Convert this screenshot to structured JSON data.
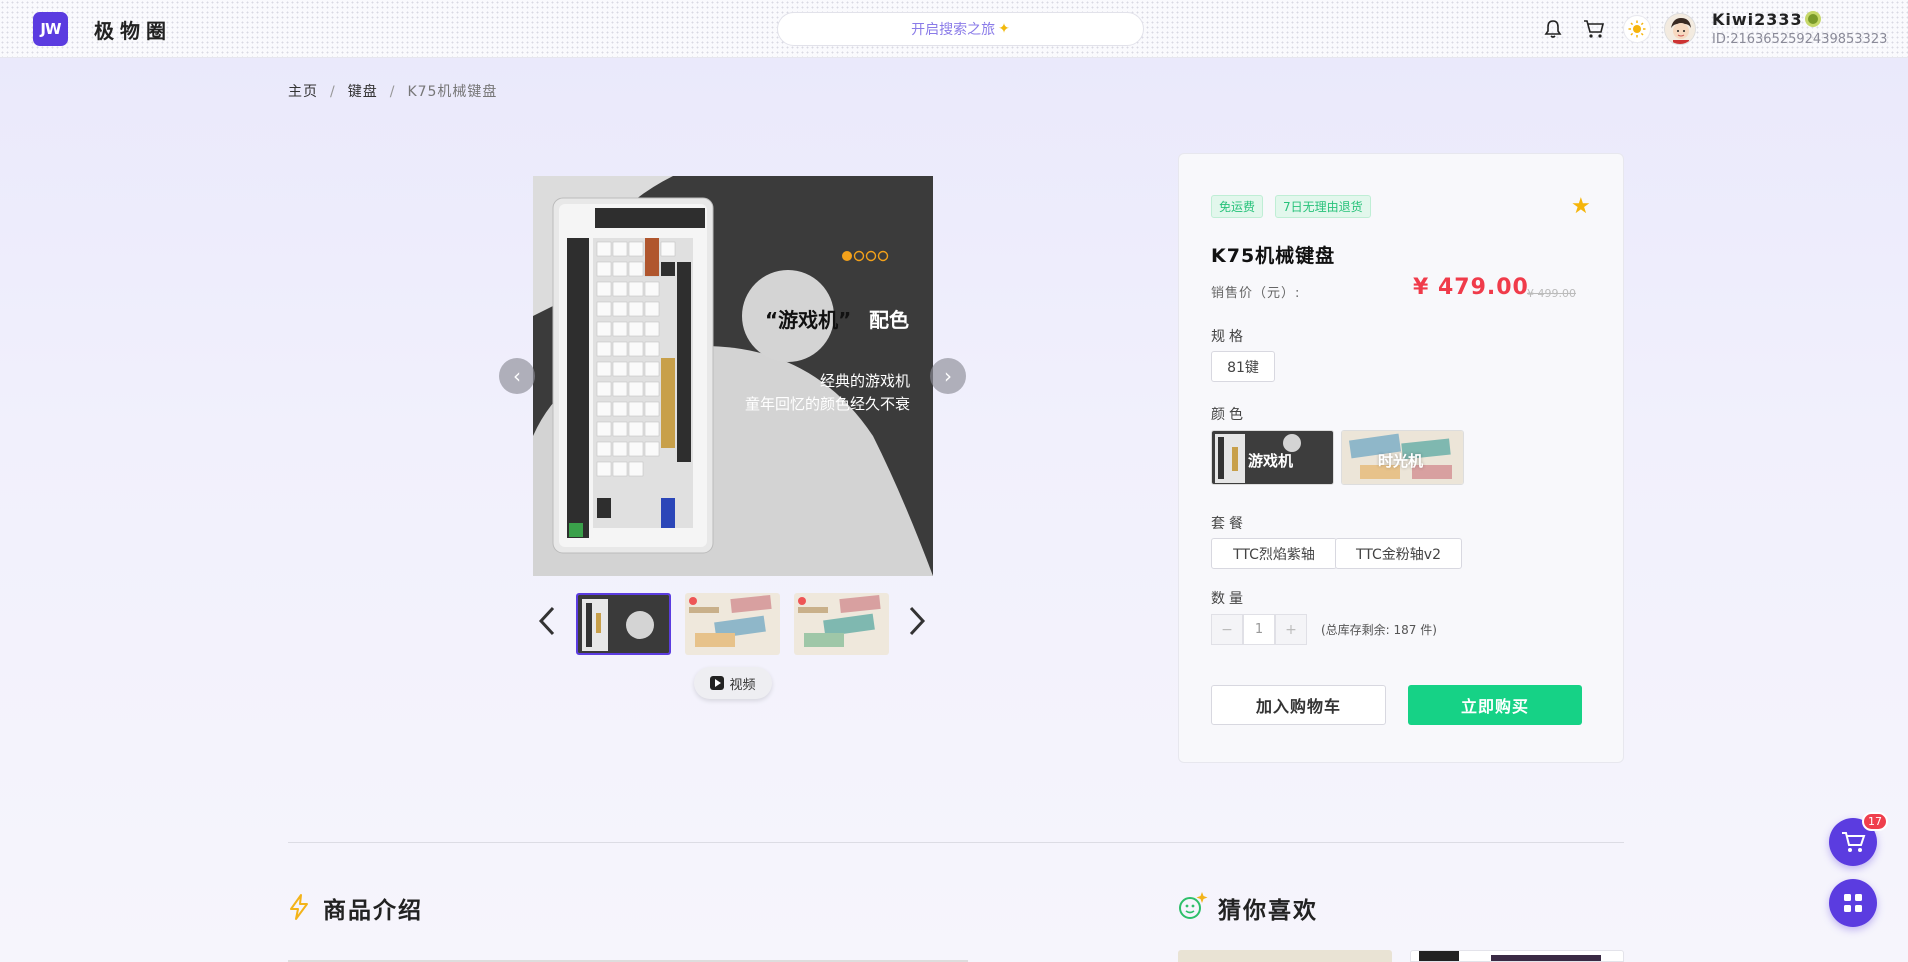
{
  "header": {
    "logo_mark": "JW",
    "site_name": "极物圈",
    "search_placeholder": "开启搜索之旅",
    "user_name": "Kiwi2333",
    "user_id": "ID:2163652592439853323"
  },
  "breadcrumb": {
    "items": [
      "主页",
      "键盘",
      "K75机械键盘"
    ]
  },
  "gallery": {
    "main_image": {
      "headline": "“游戏机”",
      "headline_suffix": "配色",
      "line1": "经典的游戏机",
      "line2": "童年回忆的颜色经久不衰"
    },
    "video_label": "视频"
  },
  "product": {
    "tags": [
      "免运费",
      "7日无理由退货"
    ],
    "title": "K75机械键盘",
    "price_label": "销售价（元）:",
    "price": "¥ 479.00",
    "original_price": "¥ 499.00",
    "spec_label": "规格",
    "specs": [
      "81键"
    ],
    "color_label": "颜色",
    "colors": [
      "游戏机",
      "时光机"
    ],
    "package_label": "套餐",
    "packages": [
      "TTC烈焰紫轴",
      "TTC金粉轴v2"
    ],
    "quantity_label": "数量",
    "quantity": "1",
    "stock_text": "(总库存剩余: 187 件)",
    "add_to_cart": "加入购物车",
    "buy_now": "立即购买"
  },
  "sections": {
    "intro_title": "商品介绍",
    "recommend_title": "猜你喜欢"
  },
  "floating": {
    "cart_count": "17"
  },
  "colors": {
    "brand": "#5b3ce0",
    "price_red": "#f03b4a",
    "buy_green": "#16d286"
  }
}
